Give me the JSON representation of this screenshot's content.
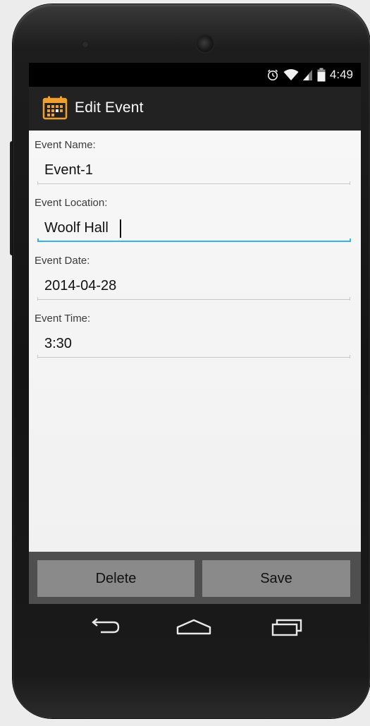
{
  "status_bar": {
    "time": "4:49",
    "icons": [
      "alarm-icon",
      "wifi-icon",
      "signal-icon",
      "battery-icon"
    ]
  },
  "action_bar": {
    "icon": "calendar-icon",
    "title": "Edit Event",
    "accent_color": "#f0a030"
  },
  "form": {
    "fields": [
      {
        "label": "Event Name:",
        "value": "Event-1",
        "focused": false
      },
      {
        "label": "Event Location:",
        "value": "Woolf Hall",
        "focused": true
      },
      {
        "label": "Event Date:",
        "value": "2014-04-28",
        "focused": false
      },
      {
        "label": "Event Time:",
        "value": "3:30",
        "focused": false
      }
    ],
    "focus_color": "#33b5e5"
  },
  "buttons": {
    "delete_label": "Delete",
    "save_label": "Save"
  },
  "nav_bar": {
    "items": [
      "back-icon",
      "home-icon",
      "recent-apps-icon"
    ]
  }
}
